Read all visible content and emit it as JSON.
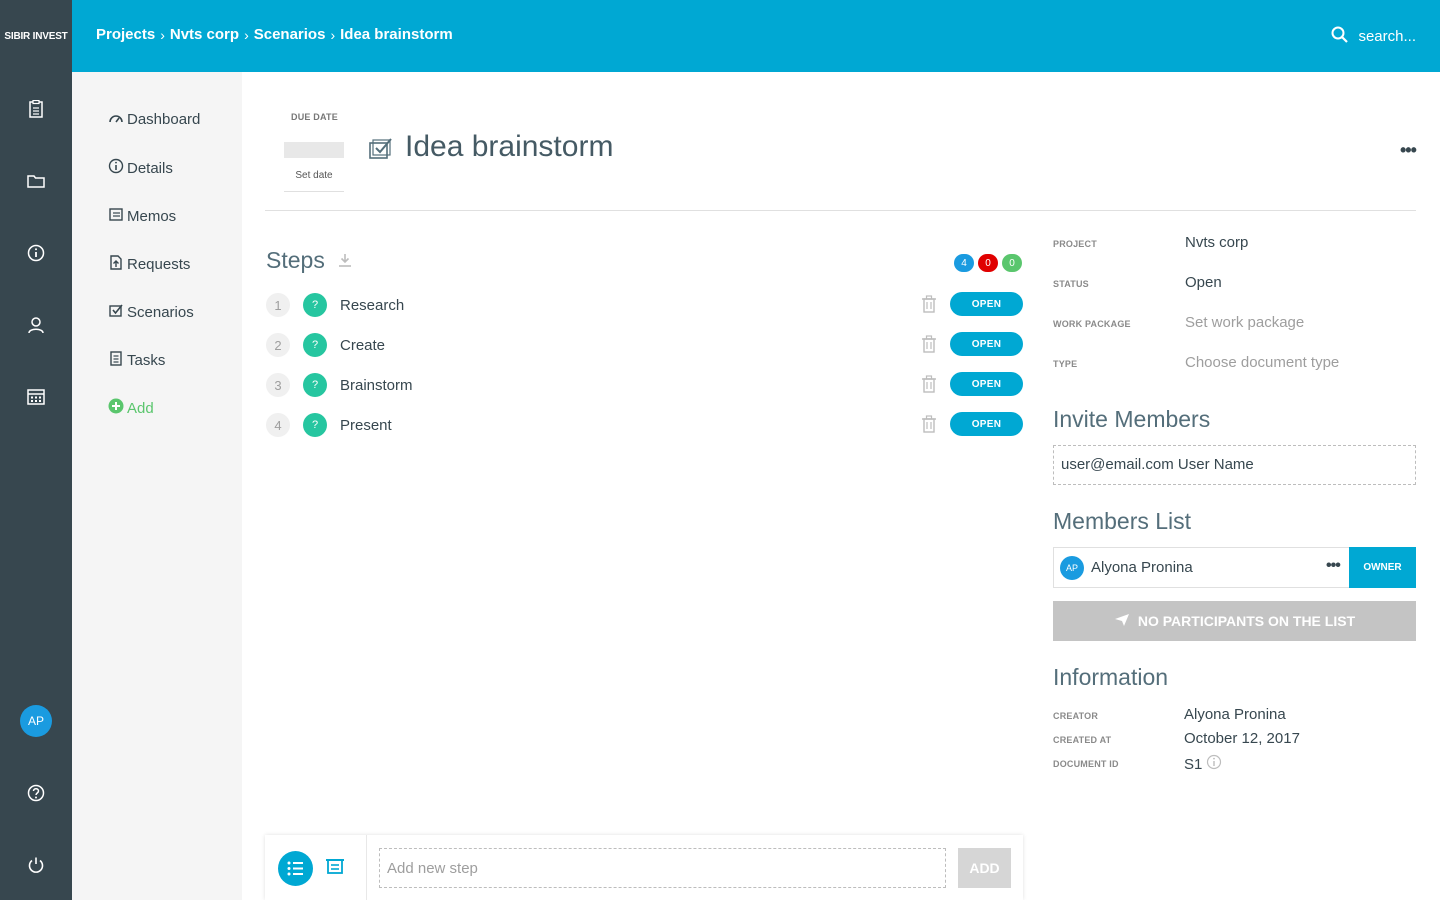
{
  "app": {
    "brand": "SIBIR INVEST",
    "user_initials": "AP"
  },
  "breadcrumb": [
    "Projects",
    "Nvts corp",
    "Scenarios",
    "Idea brainstorm"
  ],
  "search": {
    "placeholder": "search..."
  },
  "nav": {
    "items": [
      {
        "label": "Dashboard",
        "icon": "gauge-icon"
      },
      {
        "label": "Details",
        "icon": "info-icon"
      },
      {
        "label": "Memos",
        "icon": "memo-icon"
      },
      {
        "label": "Requests",
        "icon": "request-icon"
      },
      {
        "label": "Scenarios",
        "icon": "scenario-icon"
      },
      {
        "label": "Tasks",
        "icon": "clipboard-icon"
      }
    ],
    "add_label": "Add"
  },
  "document": {
    "due_date_label": "DUE DATE",
    "set_date_label": "Set date",
    "title": "Idea brainstorm"
  },
  "steps": {
    "title": "Steps",
    "counts": [
      {
        "value": "4",
        "color": "#1a9be0"
      },
      {
        "value": "0",
        "color": "#e00000"
      },
      {
        "value": "0",
        "color": "#5ac66d"
      }
    ],
    "items": [
      {
        "num": "1",
        "badge": "?",
        "name": "Research",
        "status": "OPEN"
      },
      {
        "num": "2",
        "badge": "?",
        "name": "Create",
        "status": "OPEN"
      },
      {
        "num": "3",
        "badge": "?",
        "name": "Brainstorm",
        "status": "OPEN"
      },
      {
        "num": "4",
        "badge": "?",
        "name": "Present",
        "status": "OPEN"
      }
    ]
  },
  "meta": {
    "project_label": "PROJECT",
    "project_value": "Nvts corp",
    "status_label": "STATUS",
    "status_value": "Open",
    "work_package_label": "WORK PACKAGE",
    "work_package_placeholder": "Set work package",
    "type_label": "TYPE",
    "type_placeholder": "Choose document type"
  },
  "invite": {
    "title": "Invite Members",
    "placeholder": "user@email.com User Name"
  },
  "members": {
    "title": "Members List",
    "list": [
      {
        "initials": "AP",
        "name": "Alyona Pronina",
        "role": "OWNER"
      }
    ],
    "no_participants": "NO PARTICIPANTS ON THE LIST"
  },
  "information": {
    "title": "Information",
    "creator_label": "CREATOR",
    "creator_value": "Alyona Pronina",
    "created_at_label": "CREATED AT",
    "created_at_value": "October 12, 2017",
    "document_id_label": "DOCUMENT ID",
    "document_id_value": "S1"
  },
  "add_step": {
    "placeholder": "Add new step",
    "button": "ADD"
  },
  "colors": {
    "accent": "#00a8d3",
    "rail": "#37474f",
    "step_badge": "#26c6a0",
    "add_green": "#5ac66d"
  }
}
